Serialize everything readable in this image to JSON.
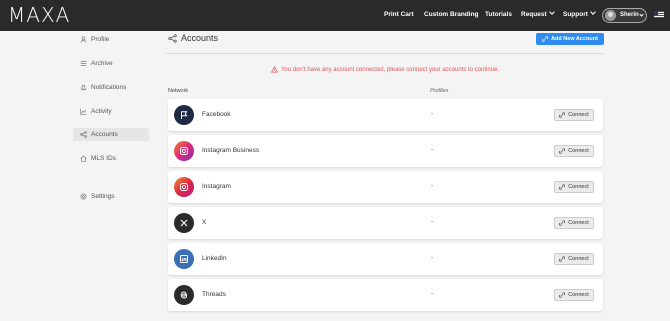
{
  "header": {
    "logo": "MAXA",
    "nav": [
      {
        "label": "Print Cart",
        "dropdown": false
      },
      {
        "label": "Custom Branding",
        "dropdown": false
      },
      {
        "label": "Tutorials",
        "dropdown": false
      },
      {
        "label": "Request",
        "dropdown": true
      },
      {
        "label": "Support",
        "dropdown": true
      }
    ],
    "user_name": "Sherin"
  },
  "sidebar": {
    "items": [
      {
        "label": "Profile",
        "icon": "user-icon"
      },
      {
        "label": "Archive",
        "icon": "archive-icon"
      },
      {
        "label": "Notifications",
        "icon": "bell-icon"
      },
      {
        "label": "Activity",
        "icon": "chart-icon"
      },
      {
        "label": "Accounts",
        "icon": "share-icon",
        "active": true
      },
      {
        "label": "MLS IDs",
        "icon": "home-icon"
      },
      {
        "label": "Settings",
        "icon": "gear-icon"
      }
    ]
  },
  "main": {
    "title": "Accounts",
    "add_button": "Add New Account",
    "warning": "You don't have any account connected, please connect your accounts to continue.",
    "columns": {
      "network": "Network",
      "profiles": "Profiles"
    },
    "accounts": [
      {
        "name": "Facebook",
        "profiles": "-",
        "icon": "flag-icon",
        "color": "#1f2a44"
      },
      {
        "name": "Instagram Business",
        "profiles": "-",
        "icon": "instagram-icon",
        "color": "#d6336c"
      },
      {
        "name": "Instagram",
        "profiles": "-",
        "icon": "instagram-icon",
        "color": "#c2368f"
      },
      {
        "name": "X",
        "profiles": "-",
        "icon": "x-icon",
        "color": "#2b2b2b"
      },
      {
        "name": "LinkedIn",
        "profiles": "-",
        "icon": "linkedin-icon",
        "color": "#3a6fb5"
      },
      {
        "name": "Threads",
        "profiles": "-",
        "icon": "threads-icon",
        "color": "#2b2b2b"
      }
    ],
    "connect_label": "Connect"
  },
  "colors": {
    "accent": "#2f8bf0",
    "warning": "#e05454",
    "topbar": "#2a2a2a"
  }
}
